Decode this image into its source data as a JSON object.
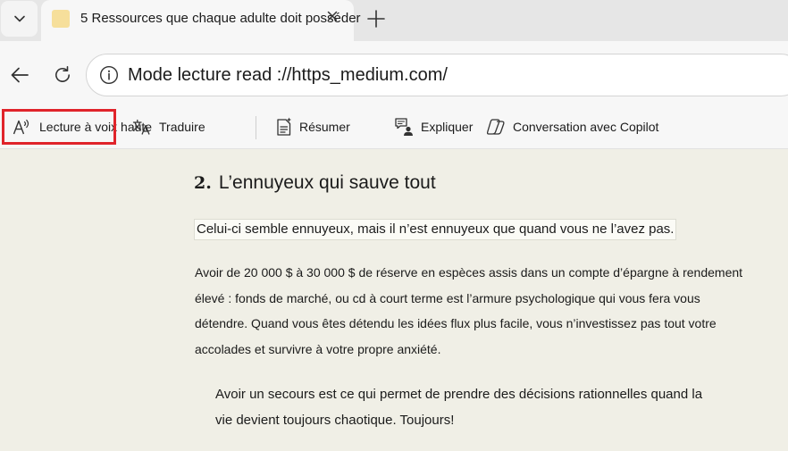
{
  "tabbar": {
    "tab_title": "5 Ressources que chaque adulte doit posséder"
  },
  "navbar": {
    "address": "Mode lecture read ://https_medium.com/"
  },
  "toolbar": {
    "read_aloud": "Lecture à voix haute",
    "translate": "Traduire",
    "summarize": "Résumer",
    "explain": "Expliquer",
    "copilot_chat": "Conversation avec Copilot"
  },
  "article": {
    "heading_number": "2.",
    "heading_text": "L’ennuyeux qui sauve tout",
    "lead": "Celui-ci semble ennuyeux, mais il n’est ennuyeux que quand vous ne l’avez pas.",
    "paragraph_lines": [
      "Avoir de 20 000 $ à 30 000 $ de réserve en espèces assis dans un compte d’épargne à rendement",
      "élevé : fonds de marché, ou cd à court terme est l’armure psychologique qui vous fera vous",
      "détendre. Quand vous êtes détendu les idées flux plus facile, vous n’investissez pas tout votre",
      "accolades et survivre à votre propre anxiété."
    ],
    "quote_lines": [
      "Avoir un secours est ce qui permet de prendre des décisions rationnelles quand la",
      "vie devient toujours chaotique. Toujours!"
    ]
  },
  "icons": {
    "tab_menu": "chevron-down-icon",
    "close": "close-icon",
    "new_tab": "plus-icon",
    "back": "back-arrow-icon",
    "refresh": "refresh-icon",
    "info": "info-icon",
    "read_aloud": "read-aloud-icon",
    "translate": "translate-icon",
    "summarize": "summarize-icon",
    "explain": "explain-icon",
    "copilot": "copilot-icon"
  },
  "colors": {
    "reader_background": "#f0efe6",
    "highlight_border": "#e0242b",
    "favicon": "#f6df9b"
  }
}
